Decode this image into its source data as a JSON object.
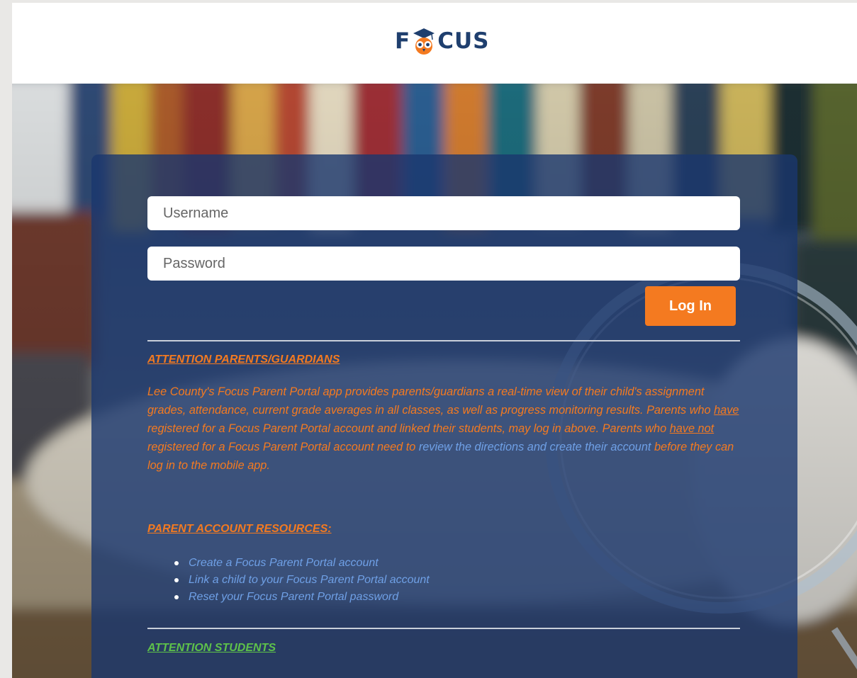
{
  "header": {
    "logo_left": "F",
    "logo_right": "CUS"
  },
  "login": {
    "username_placeholder": "Username",
    "password_placeholder": "Password",
    "login_button": "Log In"
  },
  "parents": {
    "heading": "ATTENTION PARENTS/GUARDIANS",
    "text_1": "Lee County's Focus Parent Portal app provides parents/guardians a real-time view of their child's assignment grades, attendance, current grade averages in all classes, as well as progress monitoring results. Parents who ",
    "text_have": "have",
    "text_2": " registered for a Focus Parent Portal account and linked their students, may log in above. Parents who ",
    "text_have_not": "have not",
    "text_3": " registered for a Focus Parent Portal account need to ",
    "text_link": "review the directions and create their account",
    "text_4": " before they can log in to the mobile app."
  },
  "resources": {
    "heading": "PARENT ACCOUNT RESOURCES:",
    "items": [
      "Create a Focus Parent Portal account",
      "Link a child to your Focus Parent Portal account",
      "Reset your Focus Parent Portal password"
    ]
  },
  "students": {
    "heading": "ATTENTION STUDENTS"
  },
  "colors": {
    "brand_navy": "#1f3f6e",
    "accent_orange": "#f47a20",
    "link_blue": "#6fa0e6",
    "student_green": "#5ec24a"
  }
}
